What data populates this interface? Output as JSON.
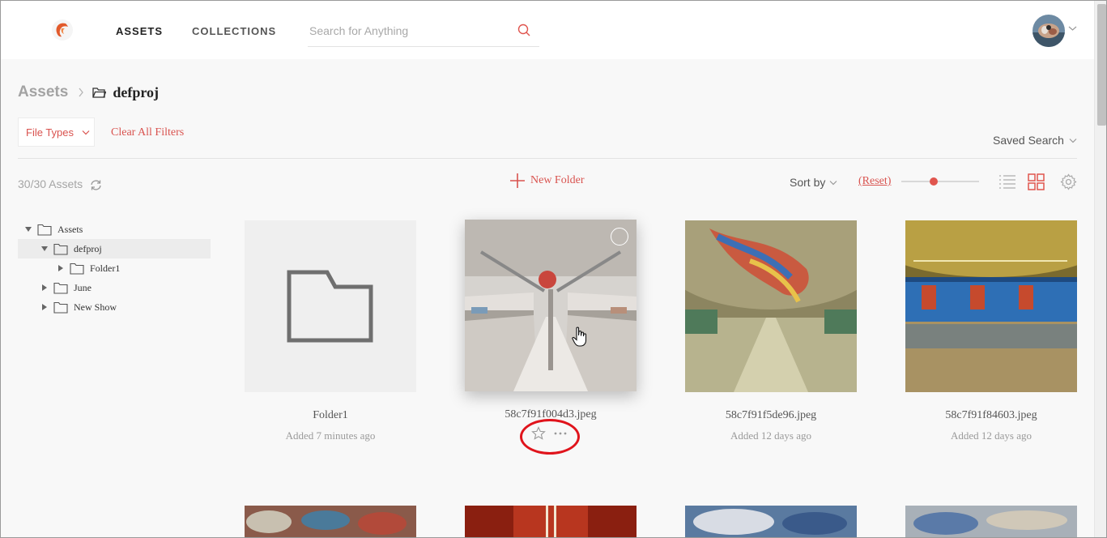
{
  "header": {
    "nav": [
      {
        "label": "ASSETS"
      },
      {
        "label": "COLLECTIONS"
      }
    ],
    "search_placeholder": "Search for Anything"
  },
  "breadcrumb": {
    "root": "Assets",
    "current": "defproj"
  },
  "filters": {
    "file_types": "File Types",
    "clear_all": "Clear All Filters",
    "saved_search": "Saved Search"
  },
  "toolbar": {
    "count": "30/30 Assets",
    "new_folder": "New Folder",
    "sort_by": "Sort by",
    "reset": "(Reset)",
    "thumbnail_size_level": 0.42
  },
  "tree": [
    {
      "label": "Assets",
      "expanded": true
    },
    {
      "label": "defproj",
      "expanded": true,
      "selected": true
    },
    {
      "label": "Folder1",
      "expanded": false
    },
    {
      "label": "June",
      "expanded": false
    },
    {
      "label": "New Show",
      "expanded": false
    }
  ],
  "assets": [
    {
      "name": "Folder1",
      "added": "Added 7 minutes ago",
      "type": "folder"
    },
    {
      "name": "58c7f91f004d3.jpeg",
      "added": "",
      "type": "image",
      "hovered": true
    },
    {
      "name": "58c7f91f5de96.jpeg",
      "added": "Added 12 days ago",
      "type": "image"
    },
    {
      "name": "58c7f91f84603.jpeg",
      "added": "Added 12 days ago",
      "type": "image"
    }
  ],
  "colors": {
    "accent": "#d9534f",
    "annotation": "#e0141c"
  }
}
